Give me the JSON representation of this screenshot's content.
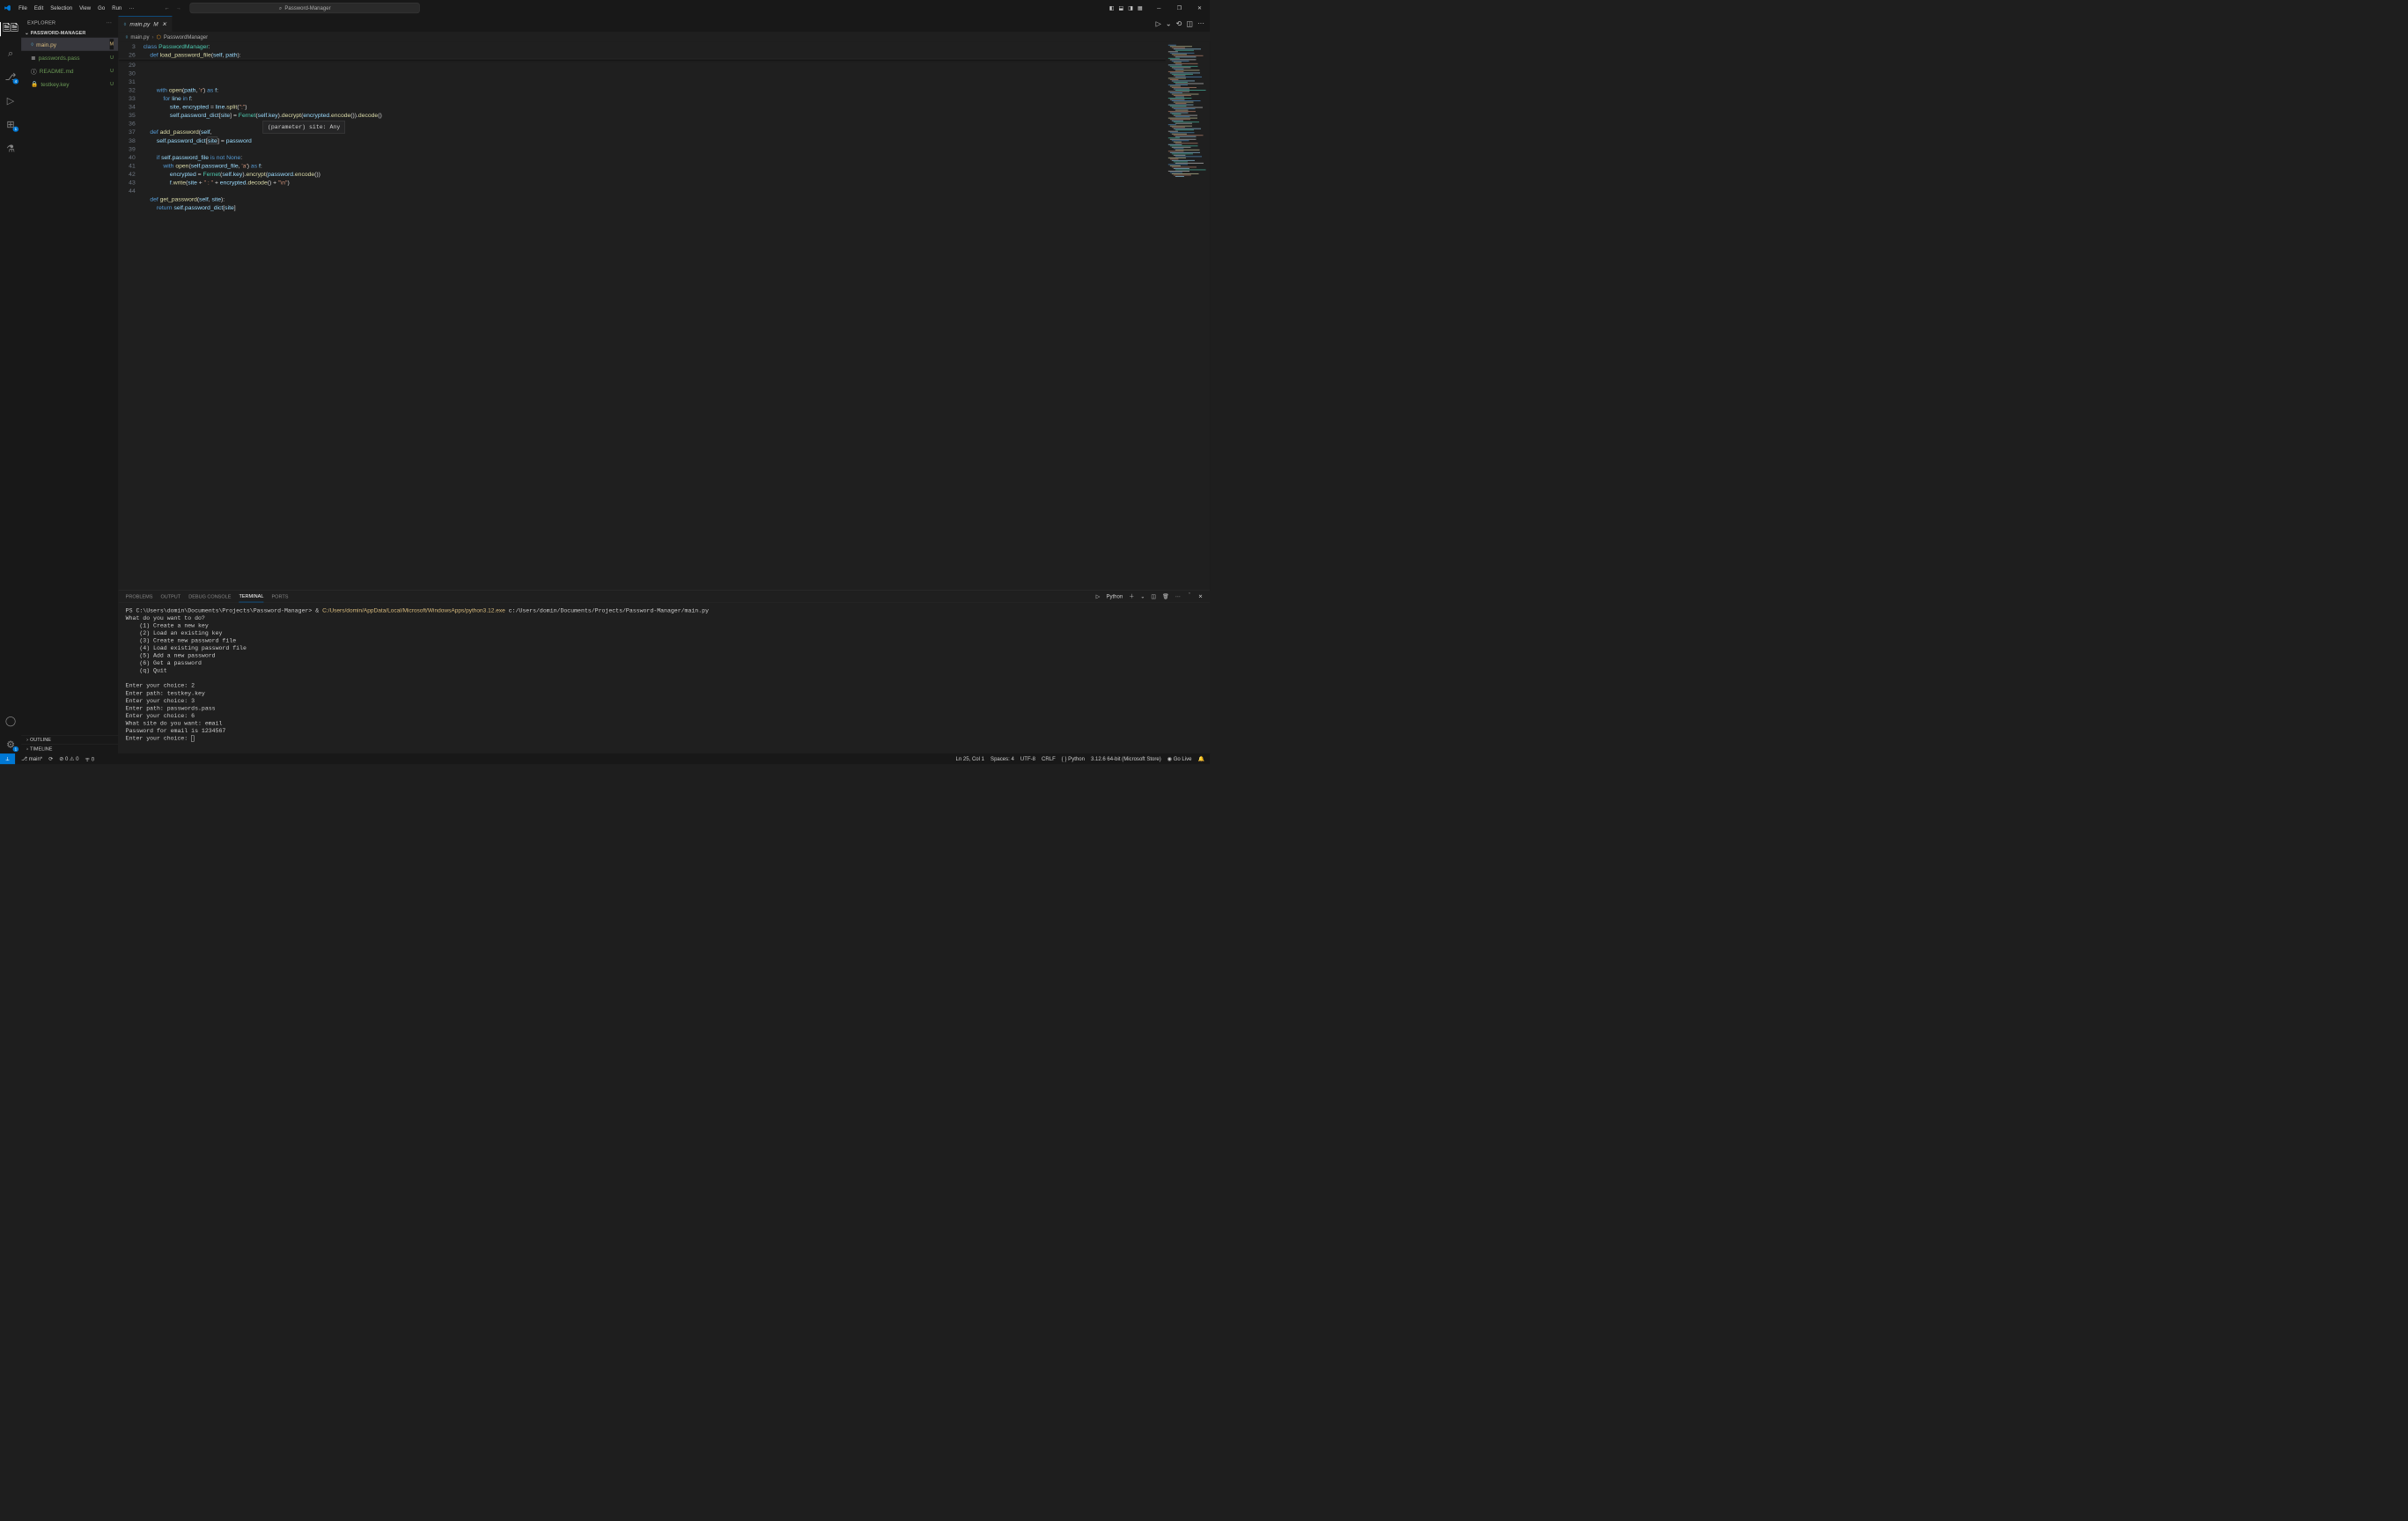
{
  "menus": [
    "File",
    "Edit",
    "Selection",
    "View",
    "Go",
    "Run"
  ],
  "title": "Password-Manager",
  "explorer": {
    "title": "EXPLORER",
    "section": "PASSWORD-MANAGER",
    "files": [
      {
        "name": "main.py",
        "status": "M",
        "cls": "mod",
        "selected": true,
        "icon": "py"
      },
      {
        "name": "passwords.pass",
        "status": "U",
        "cls": "unt",
        "icon": "txt"
      },
      {
        "name": "README.md",
        "status": "U",
        "cls": "unt",
        "icon": "info"
      },
      {
        "name": "testkey.key",
        "status": "U",
        "cls": "unt",
        "icon": "key"
      }
    ],
    "outline": "OUTLINE",
    "timeline": "TIMELINE"
  },
  "activity_badges": {
    "scm": "4",
    "ext": "1",
    "settings": "1"
  },
  "tab": {
    "label": "main.py",
    "modified": "M"
  },
  "breadcrumb": [
    "main.py",
    "PasswordManager"
  ],
  "hover": "(parameter) site: Any",
  "sticky": {
    "lines": [
      {
        "num": "3",
        "html": "<span class='tok-kw'>class</span> <span class='tok-cls'>PasswordManager</span>:"
      },
      {
        "num": "26",
        "html": "    <span class='tok-kw'>def</span> <span class='tok-fn'>load_password_file</span>(<span class='tok-self'>self</span>, <span class='tok-param'>path</span>):"
      }
    ]
  },
  "gutter": [
    "29",
    "30",
    "31",
    "32",
    "33",
    "34",
    "35",
    "36",
    "37",
    "38",
    "39",
    "40",
    "41",
    "42",
    "43",
    "44"
  ],
  "code_lines": [
    "        <span class='tok-kw'>with</span> <span class='tok-fn'>open</span>(<span class='tok-var'>path</span>, <span class='tok-str'>'r'</span>) <span class='tok-kw'>as</span> <span class='tok-var'>f</span>:",
    "            <span class='tok-kw'>for</span> <span class='tok-var'>line</span> <span class='tok-kw'>in</span> <span class='tok-var'>f</span>:",
    "                <span class='tok-var'>site</span>, <span class='tok-var'>encrypted</span> = <span class='tok-var'>line</span>.<span class='tok-fn'>split</span>(<span class='tok-str'>\":\"</span>)",
    "                <span class='tok-self'>self</span>.<span class='tok-var'>password_dict</span>[<span class='tok-var'>site</span>] = <span class='tok-cls'>Fernet</span>(<span class='tok-self'>self</span>.<span class='tok-var'>key</span>).<span class='tok-fn'>decrypt</span>(<span class='tok-var'>encrypted</span>.<span class='tok-fn'>encode</span>()).<span class='tok-fn'>decode</span>()",
    "",
    "    <span class='tok-kw'>def</span> <span class='tok-fn'>add_password</span>(<span class='tok-self'>self</span>, ",
    "        <span class='tok-self'>self</span>.<span class='tok-var'>password_dict</span>[<span class='tok-var hl'>site</span>] = <span class='tok-var'>password</span>",
    "",
    "        <span class='tok-kw'>if</span> <span class='tok-self'>self</span>.<span class='tok-var'>password_file</span> <span class='tok-kw'>is</span> <span class='tok-kw'>not</span> <span class='tok-const'>None</span>:",
    "            <span class='tok-kw'>with</span> <span class='tok-fn'>open</span>(<span class='tok-self'>self</span>.<span class='tok-var'>password_file</span>, <span class='tok-str'>'a'</span>) <span class='tok-kw'>as</span> <span class='tok-var'>f</span>:",
    "                <span class='tok-var'>encrypted</span> = <span class='tok-cls'>Fernet</span>(<span class='tok-self'>self</span>.<span class='tok-var'>key</span>).<span class='tok-fn'>encrypt</span>(<span class='tok-var'>password</span>.<span class='tok-fn'>encode</span>())",
    "                <span class='tok-var'>f</span>.<span class='tok-fn'>write</span>(<span class='tok-var'>site</span> + <span class='tok-str'>\" : \"</span> + <span class='tok-var'>encrypted</span>.<span class='tok-fn'>decode</span>() + <span class='tok-str'>\"\\n\"</span>)",
    "",
    "    <span class='tok-kw'>def</span> <span class='tok-fn'>get_password</span>(<span class='tok-self'>self</span>, <span class='tok-param'>site</span>):",
    "        <span class='tok-kw'>return</span> <span class='tok-self'>self</span>.<span class='tok-var'>password_dict</span>[<span class='tok-var'>site</span>]",
    ""
  ],
  "panel_tabs": {
    "problems": "PROBLEMS",
    "output": "OUTPUT",
    "debug": "DEBUG CONSOLE",
    "terminal": "TERMINAL",
    "ports": "PORTS",
    "lang": "Python"
  },
  "terminal_lines": [
    {
      "t": "PS C:\\Users\\domin\\Documents\\Projects\\Password-Manager> & "
    },
    {
      "t": "C:/Users/domin/AppData/Local/Microsoft/WindowsApps/python3.12.exe",
      "cls": "exe"
    },
    {
      "t": " c:/Users/domin/Documents/Projects/Password-Manager/main.py\n"
    },
    {
      "t": "What do you want to do?\n    (1) Create a new key\n    (2) Load an existing key\n    (3) Create new password file\n    (4) Load existing password file\n    (5) Add a new password\n    (6) Get a password\n    (q) Quit\n\nEnter your choice: 2\nEnter path: testkey.key\nEnter your choice: 3\nEnter path: passwords.pass\nEnter your choice: 6\nWhat site do you want: email\nPassword for email is 1234567\nEnter your choice: "
    }
  ],
  "status": {
    "branch": "main*",
    "errors": "0",
    "warnings": "0",
    "ports": "0",
    "cursor": "Ln 25, Col 1",
    "spaces": "Spaces: 4",
    "encoding": "UTF-8",
    "eol": "CRLF",
    "lang": "Python",
    "interpreter": "3.12.6 64-bit (Microsoft Store)",
    "golive": "Go Live"
  }
}
